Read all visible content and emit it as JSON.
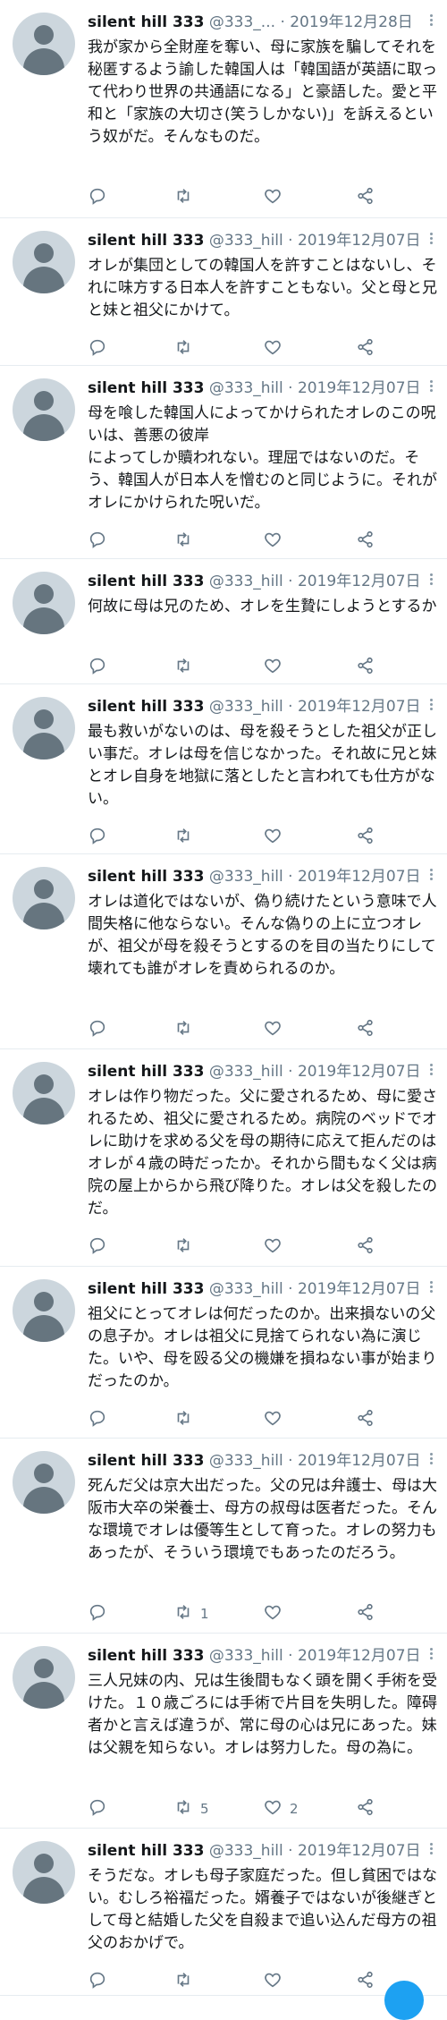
{
  "app": {
    "name": "Twitter"
  },
  "tweets": [
    {
      "user": "silent hill 333",
      "handle": "@333_...",
      "date": "· 2019年12月28日",
      "text": "我が家から全財産を奪い、母に家族を騙してそれを秘匿するよう諭した韓国人は「韓国語が英語に取って代わり世界の共通語になる」と豪語した。愛と平和と「家族の大切さ(笑うしかない)」を訴えるという奴がだ。そんなものだ。",
      "retweets": "",
      "likes": ""
    },
    {
      "user": "silent hill 333",
      "handle": "@333_hill",
      "date": "· 2019年12月07日",
      "text": "オレが集団としての韓国人を許すことはないし、それに味方する日本人を許すこともない。父と母と兄と妹と祖父にかけて。",
      "retweets": "",
      "likes": ""
    },
    {
      "user": "silent hill 333",
      "handle": "@333_hill",
      "date": "· 2019年12月07日",
      "text": "母を喰した韓国人によってかけられたオレのこの呪いは、善悪の彼岸\nによってしか贖われない。理屈ではないのだ。そう、韓国人が日本人を憎むのと同じように。それがオレにかけられた呪いだ。",
      "retweets": "",
      "likes": ""
    },
    {
      "user": "silent hill 333",
      "handle": "@333_hill",
      "date": "· 2019年12月07日",
      "text": "何故に母は兄のため、オレを生贄にしようとするか",
      "retweets": "",
      "likes": ""
    },
    {
      "user": "silent hill 333",
      "handle": "@333_hill",
      "date": "· 2019年12月07日",
      "text": "最も救いがないのは、母を殺そうとした祖父が正しい事だ。オレは母を信じなかった。それ故に兄と妹とオレ自身を地獄に落としたと言われても仕方がない。",
      "retweets": "",
      "likes": ""
    },
    {
      "user": "silent hill 333",
      "handle": "@333_hill",
      "date": "· 2019年12月07日",
      "text": "オレは道化ではないが、偽り続けたという意味で人間失格に他ならない。そんな偽りの上に立つオレが、祖父が母を殺そうとするのを目の当たりにして壊れても誰がオレを責められるのか。",
      "retweets": "",
      "likes": ""
    },
    {
      "user": "silent hill 333",
      "handle": "@333_hill",
      "date": "· 2019年12月07日",
      "text": "オレは作り物だった。父に愛されるため、母に愛されるため、祖父に愛されるため。病院のベッドでオレに助けを求める父を母の期待に応えて拒んだのはオレが４歳の時だったか。それから間もなく父は病院の屋上からから飛び降りた。オレは父を殺したのだ。",
      "retweets": "",
      "likes": ""
    },
    {
      "user": "silent hill 333",
      "handle": "@333_hill",
      "date": "· 2019年12月07日",
      "text": "祖父にとってオレは何だったのか。出来損ないの父の息子か。オレは祖父に見捨てられない為に演じた。いや、母を殴る父の機嫌を損ねない事が始まりだったのか。",
      "retweets": "",
      "likes": ""
    },
    {
      "user": "silent hill 333",
      "handle": "@333_hill",
      "date": "· 2019年12月07日",
      "text": "死んだ父は京大出だった。父の兄は弁護士、母は大阪市大卒の栄養士、母方の叔母は医者だった。そんな環境でオレは優等生として育った。オレの努力もあったが、そういう環境でもあったのだろう。",
      "retweets": "1",
      "likes": ""
    },
    {
      "user": "silent hill 333",
      "handle": "@333_hill",
      "date": "· 2019年12月07日",
      "text": "三人兄妹の内、兄は生後間もなく頭を開く手術を受けた。１０歳ごろには手術で片目を失明した。障碍者かと言えば違うが、常に母の心は兄にあった。妹は父親を知らない。オレは努力した。母の為に。",
      "retweets": "5",
      "likes": "2"
    },
    {
      "user": "silent hill 333",
      "handle": "@333_hill",
      "date": "· 2019年12月07日",
      "text": "そうだな。オレも母子家庭だった。但し貧困ではない。むしろ裕福だった。婿養子ではないが後継ぎとして母と結婚した父を自殺まで追い込んだ母方の祖父のおかげで。",
      "retweets": "",
      "likes": ""
    }
  ]
}
